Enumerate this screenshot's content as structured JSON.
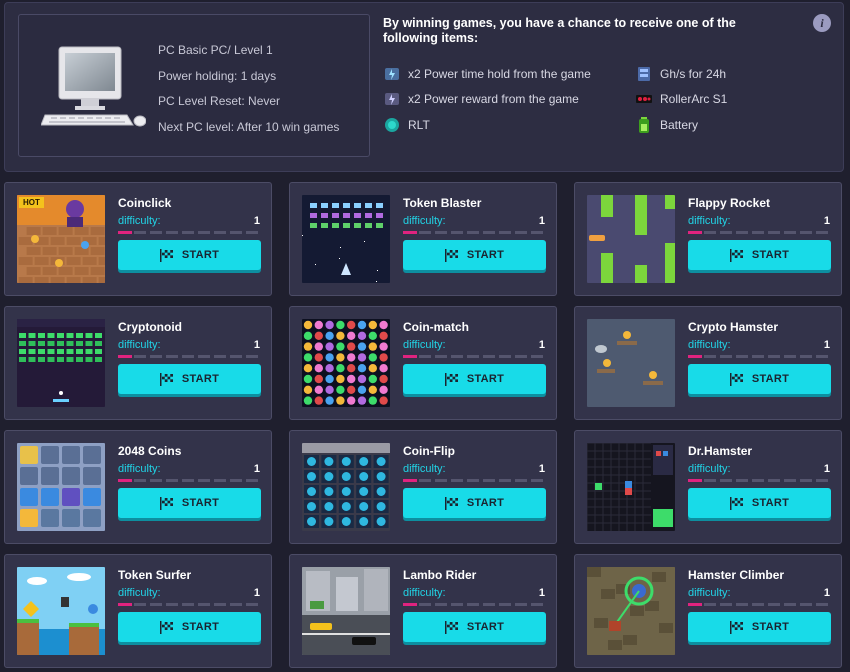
{
  "pc": {
    "model": "PC Basic PC/ Level 1",
    "power_holding": "Power holding: 1 days",
    "level_reset": "PC Level Reset: Never",
    "next_level": "Next PC level: After 10 win games"
  },
  "rewards": {
    "title": "By winning games, you have a chance to receive one of the following items:",
    "info_icon": "i",
    "items": [
      {
        "label": "x2 Power time hold from the game",
        "icon": "power-time-icon"
      },
      {
        "label": "x2 Power reward from the game",
        "icon": "power-reward-icon"
      },
      {
        "label": "RLT",
        "icon": "rlt-token-icon"
      },
      {
        "label": "Gh/s for 24h",
        "icon": "ghs-icon"
      },
      {
        "label": "RollerArc S1",
        "icon": "rollerarc-icon"
      },
      {
        "label": "Battery",
        "icon": "battery-icon"
      }
    ]
  },
  "labels": {
    "difficulty": "difficulty:",
    "start": "START",
    "hot": "HOT"
  },
  "colors": {
    "accent": "#18dbe8",
    "difficulty_fill": "#e0237f",
    "panel": "#2d2d42",
    "card": "#33334a"
  },
  "games": [
    {
      "name": "Coinclick",
      "difficulty": "1",
      "difficulty_level": 0.1,
      "hot": true,
      "thumb": "coinclick"
    },
    {
      "name": "Token Blaster",
      "difficulty": "1",
      "difficulty_level": 0.1,
      "hot": false,
      "thumb": "token-blaster"
    },
    {
      "name": "Flappy Rocket",
      "difficulty": "1",
      "difficulty_level": 0.1,
      "hot": false,
      "thumb": "flappy-rocket"
    },
    {
      "name": "Cryptonoid",
      "difficulty": "1",
      "difficulty_level": 0.1,
      "hot": false,
      "thumb": "cryptonoid"
    },
    {
      "name": "Coin-match",
      "difficulty": "1",
      "difficulty_level": 0.1,
      "hot": false,
      "thumb": "coin-match"
    },
    {
      "name": "Crypto Hamster",
      "difficulty": "1",
      "difficulty_level": 0.1,
      "hot": false,
      "thumb": "crypto-hamster"
    },
    {
      "name": "2048 Coins",
      "difficulty": "1",
      "difficulty_level": 0.1,
      "hot": false,
      "thumb": "2048-coins"
    },
    {
      "name": "Coin-Flip",
      "difficulty": "1",
      "difficulty_level": 0.1,
      "hot": false,
      "thumb": "coin-flip"
    },
    {
      "name": "Dr.Hamster",
      "difficulty": "1",
      "difficulty_level": 0.1,
      "hot": false,
      "thumb": "dr-hamster"
    },
    {
      "name": "Token Surfer",
      "difficulty": "1",
      "difficulty_level": 0.1,
      "hot": false,
      "thumb": "token-surfer"
    },
    {
      "name": "Lambo Rider",
      "difficulty": "1",
      "difficulty_level": 0.1,
      "hot": false,
      "thumb": "lambo-rider"
    },
    {
      "name": "Hamster Climber",
      "difficulty": "1",
      "difficulty_level": 0.1,
      "hot": false,
      "thumb": "hamster-climber"
    }
  ]
}
